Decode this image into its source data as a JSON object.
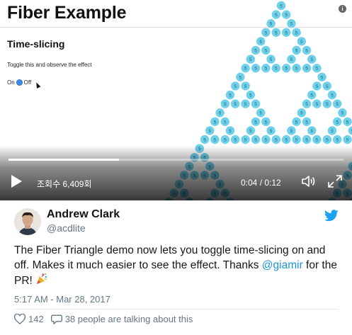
{
  "video": {
    "title": "Fiber Example",
    "section_title": "Time-slicing",
    "hint": "Toggle this and observe the effect",
    "toggle_on": "On",
    "toggle_off": "Off",
    "dot_label": "5",
    "views": "조회수 6,409회",
    "time": "0:04 / 0:12",
    "progress": 0.33,
    "accent": "#6fd0ea"
  },
  "tweet": {
    "author_name": "Andrew Clark",
    "author_handle": "@acdlite",
    "text_1": "The Fiber Triangle demo now lets you toggle time-slicing on and off. Makes it much easier to see the effect. Thanks ",
    "mention": "@giamir",
    "text_2": " for the PR! ",
    "timestamp": "5:17 AM - Mar 28, 2017",
    "likes": "142",
    "talking": "38 people are talking about this",
    "brand_color": "#1da1f2"
  }
}
